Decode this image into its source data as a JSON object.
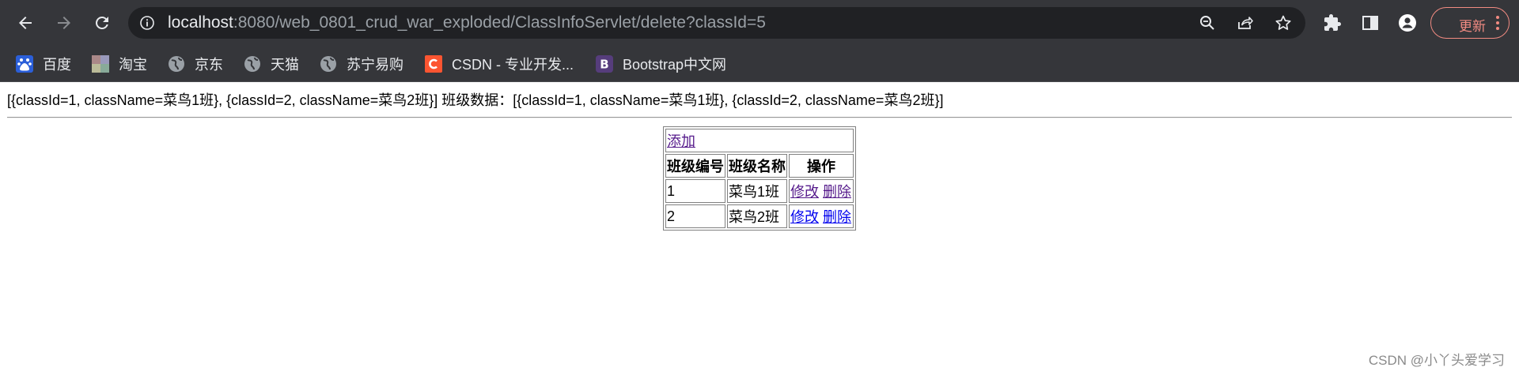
{
  "browser": {
    "url_host": "localhost",
    "url_rest": ":8080/web_0801_crud_war_exploded/ClassInfoServlet/delete?classId=5",
    "update_label": "更新",
    "icons": [
      "back-arrow-icon",
      "forward-arrow-icon",
      "reload-icon",
      "info-icon",
      "zoom-icon",
      "share-icon",
      "star-icon",
      "puzzle-icon",
      "side-panel-icon",
      "profile-icon",
      "more-vert-icon"
    ],
    "accent": "#f28b82"
  },
  "bookmarks": [
    {
      "label": "百度",
      "icon": "baidu-icon"
    },
    {
      "label": "淘宝",
      "icon": "taobao-icon"
    },
    {
      "label": "京东",
      "icon": "globe-icon"
    },
    {
      "label": "天猫",
      "icon": "globe-icon"
    },
    {
      "label": "苏宁易购",
      "icon": "globe-icon"
    },
    {
      "label": "CSDN - 专业开发...",
      "icon": "csdn-icon"
    },
    {
      "label": "Bootstrap中文网",
      "icon": "bootstrap-icon"
    }
  ],
  "page": {
    "debug_text": "[{classId=1, className=菜鸟1班}, {classId=2, className=菜鸟2班}] 班级数据：[{classId=1, className=菜鸟1班}, {classId=2, className=菜鸟2班}]",
    "add_link": "添加",
    "headers": [
      "班级编号",
      "班级名称",
      "操作"
    ],
    "rows": [
      {
        "id": "1",
        "name": "菜鸟1班",
        "edit": "修改",
        "delete": "删除"
      },
      {
        "id": "2",
        "name": "菜鸟2班",
        "edit": "修改",
        "delete": "删除"
      }
    ],
    "watermark": "CSDN @小丫头爱学习"
  }
}
